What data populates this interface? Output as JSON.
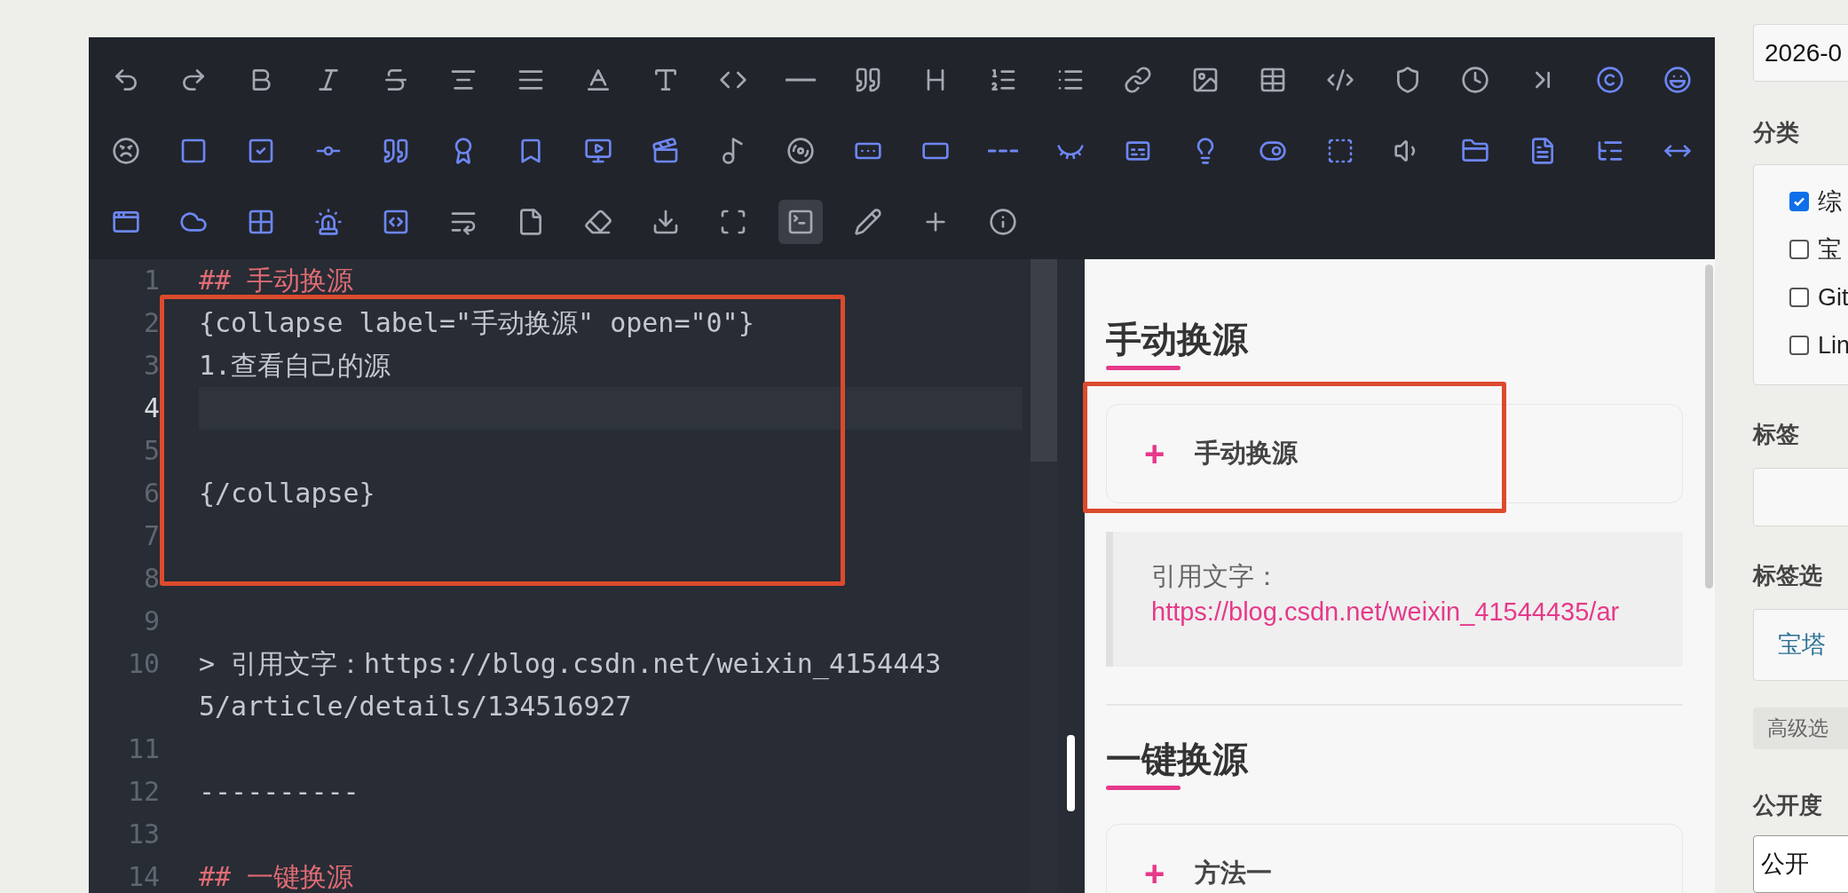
{
  "toolbar": {
    "buttons": [
      {
        "selected": false
      },
      {
        "selected": false
      },
      {
        "selected": false
      },
      {
        "selected": false
      },
      {
        "selected": false
      },
      {
        "selected": false
      },
      {
        "selected": false
      },
      {
        "selected": false
      },
      {
        "selected": false
      },
      {
        "selected": false
      },
      {
        "selected": false
      },
      {
        "selected": false
      },
      {
        "selected": false
      },
      {
        "selected": false
      },
      {
        "selected": false
      },
      {
        "selected": false
      },
      {
        "selected": false
      },
      {
        "selected": false
      },
      {
        "selected": false
      },
      {
        "selected": false
      },
      {
        "selected": false
      },
      {
        "selected": false
      },
      {
        "selected": false
      },
      {
        "selected": false
      },
      {
        "selected": false
      },
      {
        "selected": false
      },
      {
        "selected": false
      },
      {
        "selected": false
      },
      {
        "selected": false
      },
      {
        "selected": false
      },
      {
        "selected": false
      },
      {
        "selected": false
      },
      {
        "selected": false
      },
      {
        "selected": false
      },
      {
        "selected": false
      },
      {
        "selected": false
      },
      {
        "selected": false
      },
      {
        "selected": false
      },
      {
        "selected": false
      },
      {
        "selected": false
      },
      {
        "selected": false
      },
      {
        "selected": false
      },
      {
        "selected": false
      },
      {
        "selected": false
      },
      {
        "selected": false
      },
      {
        "selected": false
      },
      {
        "selected": false
      },
      {
        "selected": false
      },
      {
        "selected": false
      },
      {
        "selected": false
      },
      {
        "selected": false
      },
      {
        "selected": false
      },
      {
        "selected": false
      },
      {
        "selected": false
      },
      {
        "selected": false
      },
      {
        "selected": false
      },
      {
        "selected": false
      },
      {
        "selected": false
      },
      {
        "selected": true
      },
      {
        "selected": false
      },
      {
        "selected": false
      },
      {
        "selected": false
      }
    ]
  },
  "editor": {
    "lines": [
      {
        "number": "1",
        "text": "## 手动换源",
        "kind": "heading",
        "active": false
      },
      {
        "number": "2",
        "text": "{collapse label=\"手动换源\" open=\"0\"}",
        "kind": "plain",
        "active": false
      },
      {
        "number": "3",
        "text": "1.查看自己的源",
        "kind": "plain",
        "active": false
      },
      {
        "number": "4",
        "active": true
      },
      {
        "number": "5",
        "active": false
      },
      {
        "number": "6",
        "text": "{/collapse}",
        "kind": "plain",
        "active": false
      },
      {
        "number": "7",
        "active": false
      },
      {
        "number": "8",
        "active": false
      },
      {
        "number": "9",
        "active": false
      },
      {
        "number": "10",
        "text": "> 引用文字：https://blog.csdn.net/weixin_41544435/article/details/134516927",
        "kind": "plain",
        "active": false
      },
      {
        "number": "11",
        "active": false
      },
      {
        "number": "12",
        "text": "----------",
        "kind": "plain",
        "active": false
      },
      {
        "number": "13",
        "active": false
      },
      {
        "number": "14",
        "text": "## 一键换源",
        "kind": "heading",
        "active": false
      }
    ]
  },
  "preview": {
    "blocks": [
      {
        "kind": "heading",
        "text": "手动换源"
      },
      {
        "kind": "collapse",
        "sign": "+",
        "label": "手动换源"
      },
      {
        "kind": "quote",
        "text": "引用文字：",
        "link": "https://blog.csdn.net/weixin_41544435/ar"
      },
      {
        "kind": "rule"
      },
      {
        "kind": "heading",
        "text": "一键换源"
      },
      {
        "kind": "collapse",
        "sign": "+",
        "label": "方法一"
      }
    ]
  },
  "sidebar": {
    "date": {
      "value": "2026-0"
    },
    "category": {
      "title": "分类",
      "options": [
        {
          "label": "综",
          "checked": true
        },
        {
          "label": "宝",
          "checked": false
        },
        {
          "label": "Git",
          "checked": false
        },
        {
          "label": "Lin",
          "checked": false
        }
      ]
    },
    "tags": {
      "title": "标签"
    },
    "tag_select": {
      "title": "标签选",
      "value": "宝塔"
    },
    "advanced_button": "高级选",
    "visibility": {
      "title": "公开度",
      "value": "公开"
    }
  }
}
